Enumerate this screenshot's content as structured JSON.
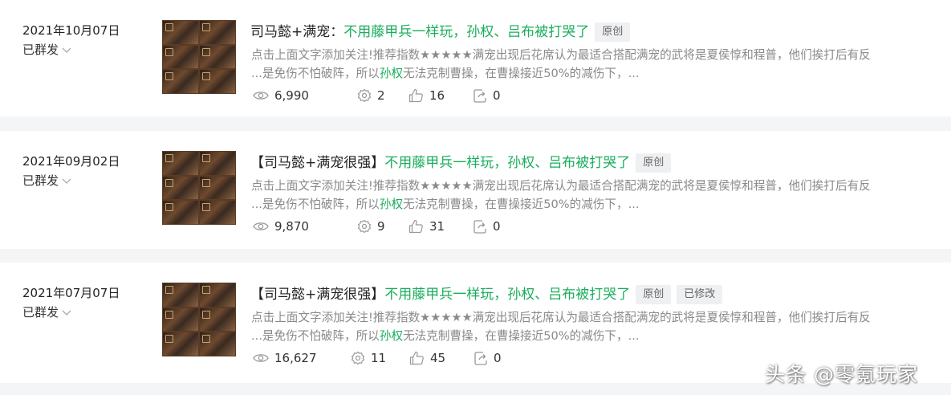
{
  "articles": [
    {
      "date": "2021年10月07日",
      "status": "已群发",
      "title_black": "司马懿+满宠：",
      "title_green": "不用藤甲兵一样玩，孙权、吕布被打哭了",
      "tags": [
        "原创"
      ],
      "summary_line1": "点击上面文字添加关注!推荐指数★★★★★满宠出现后花席认为最适合搭配满宠的武将是夏侯惇和程普，他们挨打后有反",
      "summary_line2_pre": "...是免伤不怕破阵，所以",
      "summary_line2_hl": "孙权",
      "summary_line2_post": "无法克制曹操，在曹操接近50%的减伤下，...",
      "stats": {
        "views": "6,990",
        "shares": "2",
        "likes": "16",
        "forwards": "0"
      }
    },
    {
      "date": "2021年09月02日",
      "status": "已群发",
      "title_black": "【司马懿+满宠很强】",
      "title_green": "不用藤甲兵一样玩，孙权、吕布被打哭了",
      "tags": [
        "原创"
      ],
      "summary_line1": "点击上面文字添加关注!推荐指数★★★★★满宠出现后花席认为最适合搭配满宠的武将是夏侯惇和程普，他们挨打后有反",
      "summary_line2_pre": "...是免伤不怕破阵，所以",
      "summary_line2_hl": "孙权",
      "summary_line2_post": "无法克制曹操，在曹操接近50%的减伤下，...",
      "stats": {
        "views": "9,870",
        "shares": "9",
        "likes": "31",
        "forwards": "0"
      }
    },
    {
      "date": "2021年07月07日",
      "status": "已群发",
      "title_black": "【司马懿+满宠很强】",
      "title_green": "不用藤甲兵一样玩，孙权、吕布被打哭了",
      "tags": [
        "原创",
        "已修改"
      ],
      "summary_line1": "点击上面文字添加关注!推荐指数★★★★★满宠出现后花席认为最适合搭配满宠的武将是夏侯惇和程普，他们挨打后有反",
      "summary_line2_pre": "...是免伤不怕破阵，所以",
      "summary_line2_hl": "孙权",
      "summary_line2_post": "无法克制曹操，在曹操接近50%的减伤下，...",
      "stats": {
        "views": "16,627",
        "shares": "11",
        "likes": "45",
        "forwards": "0"
      }
    }
  ],
  "icons": {
    "views": "eye-icon",
    "shares": "gear-icon",
    "likes": "thumbs-up-icon",
    "forwards": "forward-icon",
    "status": "chevron-down-icon"
  },
  "colors": {
    "accent_green": "#1aad5c",
    "summary_gray": "#8a8a8a",
    "tag_bg": "#eef0f2"
  },
  "watermark": "头条 @零氪玩家"
}
